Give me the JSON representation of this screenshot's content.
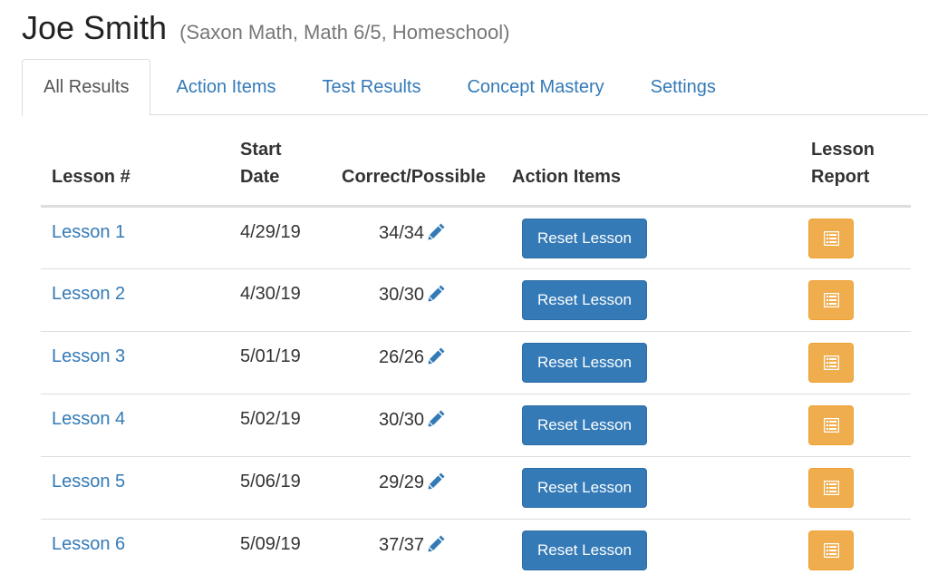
{
  "header": {
    "student_name": "Joe Smith",
    "subtitle": "(Saxon Math, Math 6/5, Homeschool)"
  },
  "tabs": [
    {
      "label": "All Results",
      "active": true
    },
    {
      "label": "Action Items",
      "active": false
    },
    {
      "label": "Test Results",
      "active": false
    },
    {
      "label": "Concept Mastery",
      "active": false
    },
    {
      "label": "Settings",
      "active": false
    }
  ],
  "table": {
    "headers": {
      "lesson": "Lesson #",
      "start_line1": "Start",
      "start_line2": "Date",
      "correct": "Correct/Possible",
      "action": "Action Items",
      "report_line1": "Lesson",
      "report_line2": "Report"
    },
    "rows": [
      {
        "lesson": "Lesson 1",
        "date": "4/29/19",
        "score": "34/34",
        "action": "Reset Lesson"
      },
      {
        "lesson": "Lesson 2",
        "date": "4/30/19",
        "score": "30/30",
        "action": "Reset Lesson"
      },
      {
        "lesson": "Lesson 3",
        "date": "5/01/19",
        "score": "26/26",
        "action": "Reset Lesson"
      },
      {
        "lesson": "Lesson 4",
        "date": "5/02/19",
        "score": "30/30",
        "action": "Reset Lesson"
      },
      {
        "lesson": "Lesson 5",
        "date": "5/06/19",
        "score": "29/29",
        "action": "Reset Lesson"
      },
      {
        "lesson": "Lesson 6",
        "date": "5/09/19",
        "score": "37/37",
        "action": "Reset Lesson"
      }
    ]
  },
  "colors": {
    "link": "#337ab7",
    "primary_button": "#337ab7",
    "warning_button": "#f0ad4e"
  },
  "icons": {
    "edit": "pencil-icon",
    "report": "list-alt-icon"
  }
}
